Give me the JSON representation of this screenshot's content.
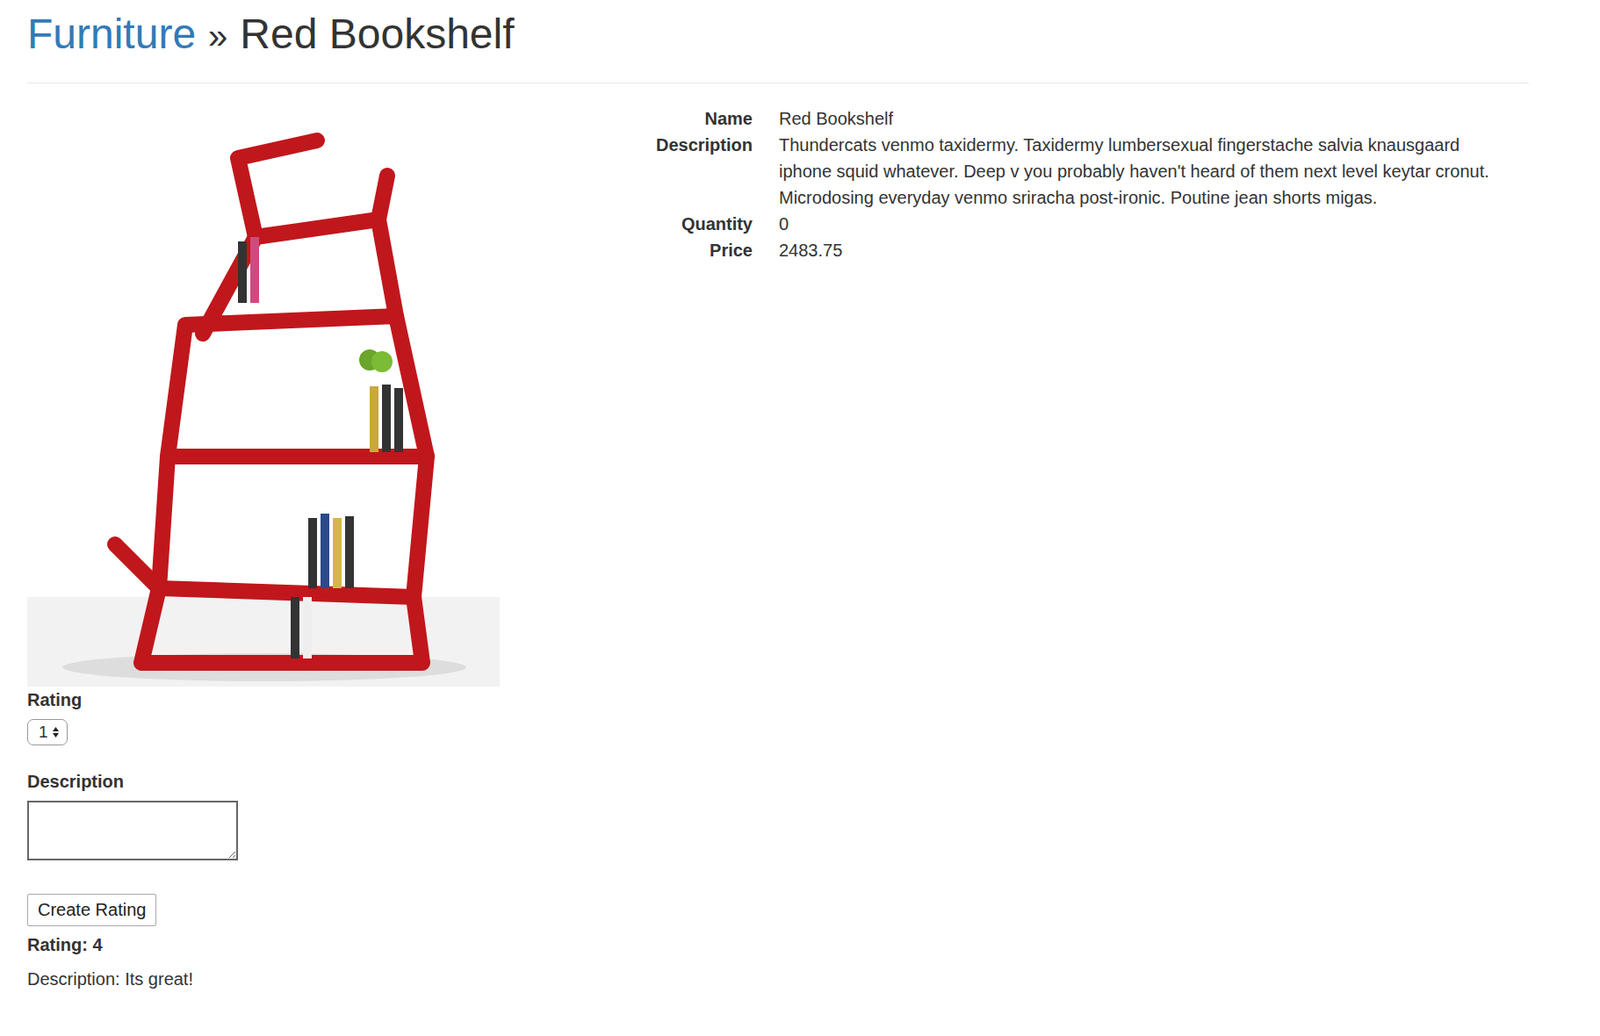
{
  "breadcrumb": {
    "parent": "Furniture",
    "separator": "»",
    "current": "Red Bookshelf"
  },
  "details": [
    {
      "label": "Name",
      "value": "Red Bookshelf"
    },
    {
      "label": "Description",
      "value": "Thundercats venmo taxidermy. Taxidermy lumbersexual fingerstache salvia knausgaard iphone squid whatever. Deep v you probably haven't heard of them next level keytar cronut. Microdosing everyday venmo sriracha post-ironic. Poutine jean shorts migas."
    },
    {
      "label": "Quantity",
      "value": "0"
    },
    {
      "label": "Price",
      "value": "2483.75"
    }
  ],
  "rating_form": {
    "rating_label": "Rating",
    "rating_value": "1",
    "description_label": "Description",
    "description_value": "",
    "submit": "Create Rating"
  },
  "ratings": [
    {
      "rating_label": "Rating:",
      "rating": "4",
      "description_label": "Description:",
      "description": "Its great!"
    }
  ]
}
